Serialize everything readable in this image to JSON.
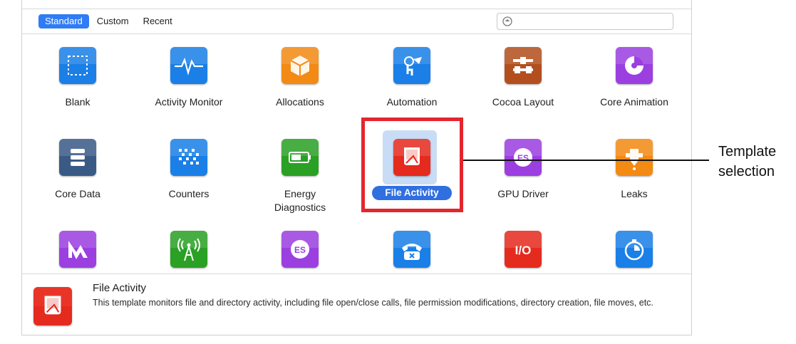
{
  "toolbar": {
    "tabs": [
      {
        "label": "Standard",
        "active": true
      },
      {
        "label": "Custom",
        "active": false
      },
      {
        "label": "Recent",
        "active": false
      }
    ],
    "search_placeholder": "",
    "search_icon": "filter-icon"
  },
  "templates": [
    {
      "label": "Blank",
      "icon": "blank-icon",
      "color": "#1a7fe6"
    },
    {
      "label": "Activity Monitor",
      "icon": "activity-monitor-icon",
      "color": "#1a7fe6"
    },
    {
      "label": "Allocations",
      "icon": "allocations-icon",
      "color": "#f28a14"
    },
    {
      "label": "Automation",
      "icon": "automation-icon",
      "color": "#1a7fe6"
    },
    {
      "label": "Cocoa Layout",
      "icon": "cocoa-layout-icon",
      "color": "#b34f1e"
    },
    {
      "label": "Core Animation",
      "icon": "core-animation-icon",
      "color": "#9b3fe0"
    },
    {
      "label": "Core Data",
      "icon": "core-data-icon",
      "color": "#3a5a86"
    },
    {
      "label": "Counters",
      "icon": "counters-icon",
      "color": "#1a7fe6"
    },
    {
      "label": "Energy\nDiagnostics",
      "icon": "energy-icon",
      "color": "#2aa024"
    },
    {
      "label": "File Activity",
      "icon": "file-activity-icon",
      "color": "#e52a1e",
      "selected": true
    },
    {
      "label": "GPU Driver",
      "icon": "gpu-driver-icon",
      "color": "#9b3fe0"
    },
    {
      "label": "Leaks",
      "icon": "leaks-icon",
      "color": "#f28a14"
    },
    {
      "label": "",
      "icon": "metal-icon",
      "color": "#9b3fe0"
    },
    {
      "label": "",
      "icon": "network-icon",
      "color": "#2aa024"
    },
    {
      "label": "",
      "icon": "opengl-es-icon",
      "color": "#9b3fe0"
    },
    {
      "label": "",
      "icon": "telephony-icon",
      "color": "#1a7fe6"
    },
    {
      "label": "",
      "icon": "system-io-icon",
      "color": "#e52a1e"
    },
    {
      "label": "",
      "icon": "time-profiler-icon",
      "color": "#1a7fe6"
    }
  ],
  "description": {
    "title": "File Activity",
    "text": "This template monitors file and directory activity, including file open/close calls, file permission modifications, directory creation, file moves, etc.",
    "icon": "file-activity-icon"
  },
  "annotation": {
    "label": "Template\nselection",
    "highlight_color": "#e3262e"
  }
}
